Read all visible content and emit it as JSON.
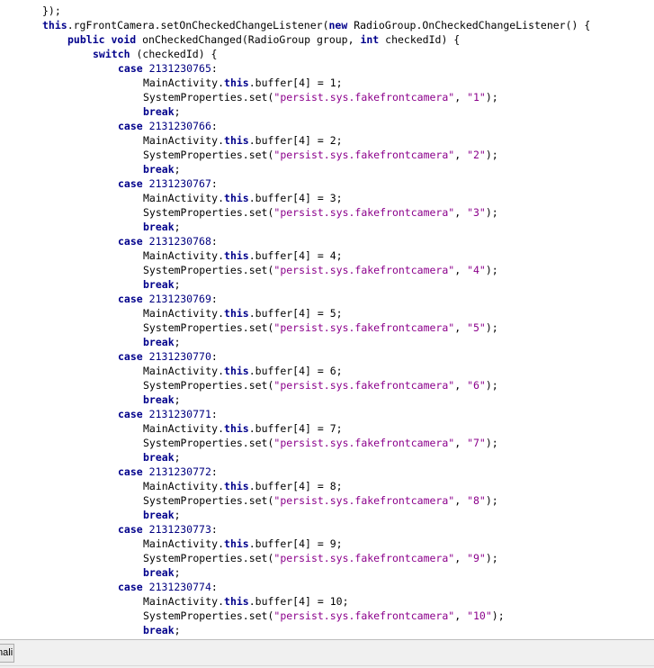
{
  "editor": {
    "language": "java",
    "lines": [
      [
        {
          "t": "plain",
          "s": "});"
        }
      ],
      [
        {
          "t": "kw",
          "s": "this"
        },
        {
          "t": "plain",
          "s": ".rgFrontCamera.setOnCheckedChangeListener("
        },
        {
          "t": "kw",
          "s": "new"
        },
        {
          "t": "plain",
          "s": " RadioGroup.OnCheckedChangeListener() {"
        }
      ],
      [
        {
          "t": "kw",
          "s": "public"
        },
        {
          "t": "plain",
          "s": " "
        },
        {
          "t": "kw",
          "s": "void"
        },
        {
          "t": "plain",
          "s": " onCheckedChanged(RadioGroup group, "
        },
        {
          "t": "kw",
          "s": "int"
        },
        {
          "t": "plain",
          "s": " checkedId) {"
        }
      ],
      [
        {
          "t": "kw",
          "s": "switch"
        },
        {
          "t": "plain",
          "s": " (checkedId) {"
        }
      ],
      [
        {
          "t": "kw",
          "s": "case"
        },
        {
          "t": "plain",
          "s": " "
        },
        {
          "t": "num",
          "s": "2131230765"
        },
        {
          "t": "plain",
          "s": ":"
        }
      ],
      [
        {
          "t": "plain",
          "s": "MainActivity."
        },
        {
          "t": "kw",
          "s": "this"
        },
        {
          "t": "plain",
          "s": ".buffer[4] = 1;"
        }
      ],
      [
        {
          "t": "plain",
          "s": "SystemProperties.set("
        },
        {
          "t": "str",
          "s": "\"persist.sys.fakefrontcamera\""
        },
        {
          "t": "plain",
          "s": ", "
        },
        {
          "t": "str",
          "s": "\"1\""
        },
        {
          "t": "plain",
          "s": ");"
        }
      ],
      [
        {
          "t": "kw",
          "s": "break"
        },
        {
          "t": "plain",
          "s": ";"
        }
      ],
      [
        {
          "t": "kw",
          "s": "case"
        },
        {
          "t": "plain",
          "s": " "
        },
        {
          "t": "num",
          "s": "2131230766"
        },
        {
          "t": "plain",
          "s": ":"
        }
      ],
      [
        {
          "t": "plain",
          "s": "MainActivity."
        },
        {
          "t": "kw",
          "s": "this"
        },
        {
          "t": "plain",
          "s": ".buffer[4] = 2;"
        }
      ],
      [
        {
          "t": "plain",
          "s": "SystemProperties.set("
        },
        {
          "t": "str",
          "s": "\"persist.sys.fakefrontcamera\""
        },
        {
          "t": "plain",
          "s": ", "
        },
        {
          "t": "str",
          "s": "\"2\""
        },
        {
          "t": "plain",
          "s": ");"
        }
      ],
      [
        {
          "t": "kw",
          "s": "break"
        },
        {
          "t": "plain",
          "s": ";"
        }
      ],
      [
        {
          "t": "kw",
          "s": "case"
        },
        {
          "t": "plain",
          "s": " "
        },
        {
          "t": "num",
          "s": "2131230767"
        },
        {
          "t": "plain",
          "s": ":"
        }
      ],
      [
        {
          "t": "plain",
          "s": "MainActivity."
        },
        {
          "t": "kw",
          "s": "this"
        },
        {
          "t": "plain",
          "s": ".buffer[4] = 3;"
        }
      ],
      [
        {
          "t": "plain",
          "s": "SystemProperties.set("
        },
        {
          "t": "str",
          "s": "\"persist.sys.fakefrontcamera\""
        },
        {
          "t": "plain",
          "s": ", "
        },
        {
          "t": "str",
          "s": "\"3\""
        },
        {
          "t": "plain",
          "s": ");"
        }
      ],
      [
        {
          "t": "kw",
          "s": "break"
        },
        {
          "t": "plain",
          "s": ";"
        }
      ],
      [
        {
          "t": "kw",
          "s": "case"
        },
        {
          "t": "plain",
          "s": " "
        },
        {
          "t": "num",
          "s": "2131230768"
        },
        {
          "t": "plain",
          "s": ":"
        }
      ],
      [
        {
          "t": "plain",
          "s": "MainActivity."
        },
        {
          "t": "kw",
          "s": "this"
        },
        {
          "t": "plain",
          "s": ".buffer[4] = 4;"
        }
      ],
      [
        {
          "t": "plain",
          "s": "SystemProperties.set("
        },
        {
          "t": "str",
          "s": "\"persist.sys.fakefrontcamera\""
        },
        {
          "t": "plain",
          "s": ", "
        },
        {
          "t": "str",
          "s": "\"4\""
        },
        {
          "t": "plain",
          "s": ");"
        }
      ],
      [
        {
          "t": "kw",
          "s": "break"
        },
        {
          "t": "plain",
          "s": ";"
        }
      ],
      [
        {
          "t": "kw",
          "s": "case"
        },
        {
          "t": "plain",
          "s": " "
        },
        {
          "t": "num",
          "s": "2131230769"
        },
        {
          "t": "plain",
          "s": ":"
        }
      ],
      [
        {
          "t": "plain",
          "s": "MainActivity."
        },
        {
          "t": "kw",
          "s": "this"
        },
        {
          "t": "plain",
          "s": ".buffer[4] = 5;"
        }
      ],
      [
        {
          "t": "plain",
          "s": "SystemProperties.set("
        },
        {
          "t": "str",
          "s": "\"persist.sys.fakefrontcamera\""
        },
        {
          "t": "plain",
          "s": ", "
        },
        {
          "t": "str",
          "s": "\"5\""
        },
        {
          "t": "plain",
          "s": ");"
        }
      ],
      [
        {
          "t": "kw",
          "s": "break"
        },
        {
          "t": "plain",
          "s": ";"
        }
      ],
      [
        {
          "t": "kw",
          "s": "case"
        },
        {
          "t": "plain",
          "s": " "
        },
        {
          "t": "num",
          "s": "2131230770"
        },
        {
          "t": "plain",
          "s": ":"
        }
      ],
      [
        {
          "t": "plain",
          "s": "MainActivity."
        },
        {
          "t": "kw",
          "s": "this"
        },
        {
          "t": "plain",
          "s": ".buffer[4] = 6;"
        }
      ],
      [
        {
          "t": "plain",
          "s": "SystemProperties.set("
        },
        {
          "t": "str",
          "s": "\"persist.sys.fakefrontcamera\""
        },
        {
          "t": "plain",
          "s": ", "
        },
        {
          "t": "str",
          "s": "\"6\""
        },
        {
          "t": "plain",
          "s": ");"
        }
      ],
      [
        {
          "t": "kw",
          "s": "break"
        },
        {
          "t": "plain",
          "s": ";"
        }
      ],
      [
        {
          "t": "kw",
          "s": "case"
        },
        {
          "t": "plain",
          "s": " "
        },
        {
          "t": "num",
          "s": "2131230771"
        },
        {
          "t": "plain",
          "s": ":"
        }
      ],
      [
        {
          "t": "plain",
          "s": "MainActivity."
        },
        {
          "t": "kw",
          "s": "this"
        },
        {
          "t": "plain",
          "s": ".buffer[4] = 7;"
        }
      ],
      [
        {
          "t": "plain",
          "s": "SystemProperties.set("
        },
        {
          "t": "str",
          "s": "\"persist.sys.fakefrontcamera\""
        },
        {
          "t": "plain",
          "s": ", "
        },
        {
          "t": "str",
          "s": "\"7\""
        },
        {
          "t": "plain",
          "s": ");"
        }
      ],
      [
        {
          "t": "kw",
          "s": "break"
        },
        {
          "t": "plain",
          "s": ";"
        }
      ],
      [
        {
          "t": "kw",
          "s": "case"
        },
        {
          "t": "plain",
          "s": " "
        },
        {
          "t": "num",
          "s": "2131230772"
        },
        {
          "t": "plain",
          "s": ":"
        }
      ],
      [
        {
          "t": "plain",
          "s": "MainActivity."
        },
        {
          "t": "kw",
          "s": "this"
        },
        {
          "t": "plain",
          "s": ".buffer[4] = 8;"
        }
      ],
      [
        {
          "t": "plain",
          "s": "SystemProperties.set("
        },
        {
          "t": "str",
          "s": "\"persist.sys.fakefrontcamera\""
        },
        {
          "t": "plain",
          "s": ", "
        },
        {
          "t": "str",
          "s": "\"8\""
        },
        {
          "t": "plain",
          "s": ");"
        }
      ],
      [
        {
          "t": "kw",
          "s": "break"
        },
        {
          "t": "plain",
          "s": ";"
        }
      ],
      [
        {
          "t": "kw",
          "s": "case"
        },
        {
          "t": "plain",
          "s": " "
        },
        {
          "t": "num",
          "s": "2131230773"
        },
        {
          "t": "plain",
          "s": ":"
        }
      ],
      [
        {
          "t": "plain",
          "s": "MainActivity."
        },
        {
          "t": "kw",
          "s": "this"
        },
        {
          "t": "plain",
          "s": ".buffer[4] = 9;"
        }
      ],
      [
        {
          "t": "plain",
          "s": "SystemProperties.set("
        },
        {
          "t": "str",
          "s": "\"persist.sys.fakefrontcamera\""
        },
        {
          "t": "plain",
          "s": ", "
        },
        {
          "t": "str",
          "s": "\"9\""
        },
        {
          "t": "plain",
          "s": ");"
        }
      ],
      [
        {
          "t": "kw",
          "s": "break"
        },
        {
          "t": "plain",
          "s": ";"
        }
      ],
      [
        {
          "t": "kw",
          "s": "case"
        },
        {
          "t": "plain",
          "s": " "
        },
        {
          "t": "num",
          "s": "2131230774"
        },
        {
          "t": "plain",
          "s": ":"
        }
      ],
      [
        {
          "t": "plain",
          "s": "MainActivity."
        },
        {
          "t": "kw",
          "s": "this"
        },
        {
          "t": "plain",
          "s": ".buffer[4] = 10;"
        }
      ],
      [
        {
          "t": "plain",
          "s": "SystemProperties.set("
        },
        {
          "t": "str",
          "s": "\"persist.sys.fakefrontcamera\""
        },
        {
          "t": "plain",
          "s": ", "
        },
        {
          "t": "str",
          "s": "\"10\""
        },
        {
          "t": "plain",
          "s": ");"
        }
      ],
      [
        {
          "t": "kw",
          "s": "break"
        },
        {
          "t": "plain",
          "s": ";"
        }
      ]
    ]
  },
  "bottom_bar": {
    "tab_label": "mali"
  },
  "colors": {
    "keyword": "#00008b",
    "string": "#8b008b",
    "number": "#000080",
    "text": "#000000",
    "background": "#ffffff",
    "bottom_bar": "#f0f0f0"
  }
}
